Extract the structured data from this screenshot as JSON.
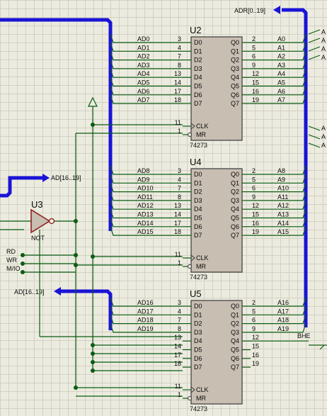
{
  "chips": [
    {
      "ref": "U2",
      "part": "74273",
      "inputs": [
        "AD0",
        "AD1",
        "AD2",
        "AD3",
        "AD4",
        "AD5",
        "AD6",
        "AD7"
      ],
      "in_pins": [
        "3",
        "4",
        "7",
        "8",
        "13",
        "14",
        "17",
        "18"
      ],
      "d_names": [
        "D0",
        "D1",
        "D2",
        "D3",
        "D4",
        "D5",
        "D6",
        "D7"
      ],
      "q_names": [
        "Q0",
        "Q1",
        "Q2",
        "Q3",
        "Q4",
        "Q5",
        "Q6",
        "Q7"
      ],
      "out_pins": [
        "2",
        "5",
        "6",
        "9",
        "12",
        "15",
        "16",
        "19"
      ],
      "outputs": [
        "A0",
        "A1",
        "A2",
        "A3",
        "A4",
        "A5",
        "A6",
        "A7"
      ],
      "clk_pin": "11",
      "clk_name": "CLK",
      "mr_pin": "1",
      "mr_name": "MR"
    },
    {
      "ref": "U4",
      "part": "74273",
      "inputs": [
        "AD8",
        "AD9",
        "AD10",
        "AD11",
        "AD12",
        "AD13",
        "AD14",
        "AD15"
      ],
      "in_pins": [
        "3",
        "4",
        "7",
        "8",
        "13",
        "14",
        "17",
        "18"
      ],
      "d_names": [
        "D0",
        "D1",
        "D2",
        "D3",
        "D4",
        "D5",
        "D6",
        "D7"
      ],
      "q_names": [
        "Q0",
        "Q1",
        "Q2",
        "Q3",
        "Q4",
        "Q5",
        "Q6",
        "Q7"
      ],
      "out_pins": [
        "2",
        "5",
        "6",
        "9",
        "12",
        "15",
        "16",
        "19"
      ],
      "outputs": [
        "A8",
        "A9",
        "A10",
        "A11",
        "A12",
        "A13",
        "A14",
        "A15"
      ],
      "clk_pin": "11",
      "clk_name": "CLK",
      "mr_pin": "1",
      "mr_name": "MR"
    },
    {
      "ref": "U5",
      "part": "74273",
      "inputs": [
        "AD16",
        "AD17",
        "AD18",
        "AD19",
        "",
        "",
        "",
        ""
      ],
      "in_pins": [
        "3",
        "4",
        "7",
        "8",
        "13",
        "14",
        "17",
        "18"
      ],
      "d_names": [
        "D0",
        "D1",
        "D2",
        "D3",
        "D4",
        "D5",
        "D6",
        "D7"
      ],
      "q_names": [
        "Q0",
        "Q1",
        "Q2",
        "Q3",
        "Q4",
        "Q5",
        "Q6",
        "Q7"
      ],
      "out_pins": [
        "2",
        "5",
        "6",
        "9",
        "12",
        "15",
        "16",
        "19"
      ],
      "outputs": [
        "A16",
        "A17",
        "A18",
        "A19",
        "BHE",
        "",
        "",
        ""
      ],
      "clk_pin": "11",
      "clk_name": "CLK",
      "mr_pin": "1",
      "mr_name": "MR"
    }
  ],
  "gate": {
    "ref": "U3",
    "part": "NOT"
  },
  "buses": {
    "adr_label": "ADR[0..19]",
    "ad_label_right": "AD[16..19]",
    "ad_label_left": "AD[16..19]"
  },
  "signals": [
    "RD",
    "WR",
    "M/IO"
  ],
  "edge_labels": [
    "A",
    "A",
    "A",
    "A",
    "A",
    "A",
    "A"
  ],
  "colors": {
    "wire": "#0a5c12",
    "bus": "#1a14d6",
    "chip_fill": "#c8beb2",
    "chip_border": "#3a3a3a",
    "pin_text": "#0b0b0b"
  }
}
